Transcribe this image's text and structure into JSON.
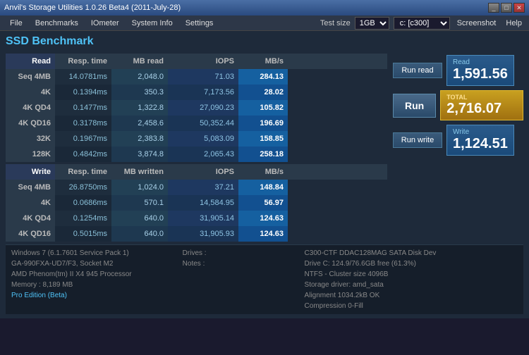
{
  "titleBar": {
    "title": "Anvil's Storage Utilities 1.0.26 Beta4 (2011-July-28)"
  },
  "menuBar": {
    "items": [
      "File",
      "Benchmarks",
      "IOmeter",
      "System Info",
      "Settings"
    ],
    "testSizeLabel": "Test size",
    "testSizeValue": "1GB",
    "driveLabel": "c: [c300]",
    "screenshotLabel": "Screenshot",
    "helpLabel": "Help"
  },
  "mainTitle": "SSD Benchmark",
  "table": {
    "readHeader": [
      "Read",
      "Resp. time",
      "MB read",
      "IOPS",
      "MB/s"
    ],
    "writeHeader": [
      "Write",
      "Resp. time",
      "MB written",
      "IOPS",
      "MB/s"
    ],
    "readRows": [
      {
        "label": "Seq 4MB",
        "resp": "14.0781ms",
        "mb": "2,048.0",
        "iops": "71.03",
        "mbs": "284.13"
      },
      {
        "label": "4K",
        "resp": "0.1394ms",
        "mb": "350.3",
        "iops": "7,173.56",
        "mbs": "28.02"
      },
      {
        "label": "4K QD4",
        "resp": "0.1477ms",
        "mb": "1,322.8",
        "iops": "27,090.23",
        "mbs": "105.82"
      },
      {
        "label": "4K QD16",
        "resp": "0.3178ms",
        "mb": "2,458.6",
        "iops": "50,352.44",
        "mbs": "196.69"
      },
      {
        "label": "32K",
        "resp": "0.1967ms",
        "mb": "2,383.8",
        "iops": "5,083.09",
        "mbs": "158.85"
      },
      {
        "label": "128K",
        "resp": "0.4842ms",
        "mb": "3,874.8",
        "iops": "2,065.43",
        "mbs": "258.18"
      }
    ],
    "writeRows": [
      {
        "label": "Seq 4MB",
        "resp": "26.8750ms",
        "mb": "1,024.0",
        "iops": "37.21",
        "mbs": "148.84"
      },
      {
        "label": "4K",
        "resp": "0.0686ms",
        "mb": "570.1",
        "iops": "14,584.95",
        "mbs": "56.97"
      },
      {
        "label": "4K QD4",
        "resp": "0.1254ms",
        "mb": "640.0",
        "iops": "31,905.14",
        "mbs": "124.63"
      },
      {
        "label": "4K QD16",
        "resp": "0.5015ms",
        "mb": "640.0",
        "iops": "31,905.93",
        "mbs": "124.63"
      }
    ]
  },
  "scores": {
    "readLabel": "Read",
    "readValue": "1,591.56",
    "totalLabel": "TOTAL",
    "totalValue": "2,716.07",
    "writeLabel": "Write",
    "writeValue": "1,124.51"
  },
  "buttons": {
    "runRead": "Run read",
    "run": "Run",
    "runWrite": "Run write"
  },
  "bottomBar": {
    "sysInfo": [
      "Windows 7 (6.1.7601 Service Pack 1)",
      "GA-990FXA-UD7/F3, Socket M2",
      "AMD Phenom(tm) II X4 945 Processor",
      "Memory : 8,189 MB"
    ],
    "proLabel": "Pro Edition (Beta)",
    "drivesLabel": "Drives :",
    "notesLabel": "Notes :",
    "diskInfo": [
      "C300-CTF DDAC128MAG SATA Disk Dev",
      "Drive C: 124.9/76.6GB free (61.3%)",
      "NTFS - Cluster size 4096B",
      "Storage driver: amd_sata",
      "Alignment 1034.2kB OK",
      "Compression 0-Fill"
    ]
  }
}
